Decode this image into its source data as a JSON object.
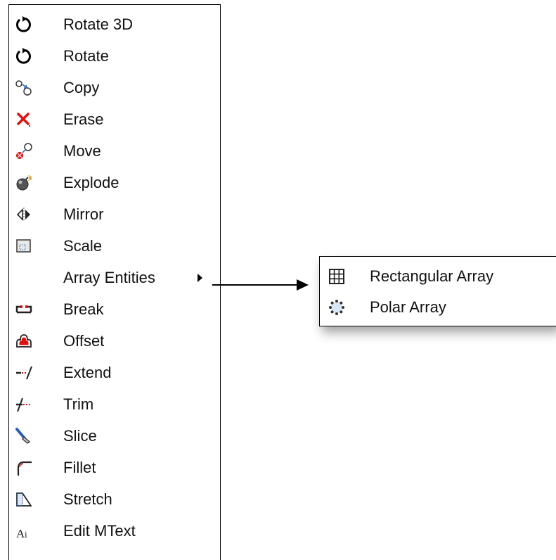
{
  "menu": {
    "items": [
      {
        "label": "Rotate 3D",
        "icon": "rotate-3d-icon"
      },
      {
        "label": "Rotate",
        "icon": "rotate-icon"
      },
      {
        "label": "Copy",
        "icon": "copy-icon"
      },
      {
        "label": "Erase",
        "icon": "erase-icon"
      },
      {
        "label": "Move",
        "icon": "move-icon"
      },
      {
        "label": "Explode",
        "icon": "explode-icon"
      },
      {
        "label": "Mirror",
        "icon": "mirror-icon"
      },
      {
        "label": "Scale",
        "icon": "scale-icon"
      },
      {
        "label": "Array Entities",
        "icon": "",
        "has_submenu": true
      },
      {
        "label": "Break",
        "icon": "break-icon"
      },
      {
        "label": "Offset",
        "icon": "offset-icon"
      },
      {
        "label": "Extend",
        "icon": "extend-icon"
      },
      {
        "label": "Trim",
        "icon": "trim-icon"
      },
      {
        "label": "Slice",
        "icon": "slice-icon"
      },
      {
        "label": "Fillet",
        "icon": "fillet-icon"
      },
      {
        "label": "Stretch",
        "icon": "stretch-icon"
      },
      {
        "label": "Edit MText",
        "icon": "edit-mtext-icon"
      }
    ]
  },
  "submenu": {
    "items": [
      {
        "label": "Rectangular Array",
        "icon": "rectangular-array-icon"
      },
      {
        "label": "Polar Array",
        "icon": "polar-array-icon"
      }
    ]
  },
  "colors": {
    "erase_red": "#e01010",
    "icon_blue": "#2a5fb0",
    "text": "#111111"
  }
}
